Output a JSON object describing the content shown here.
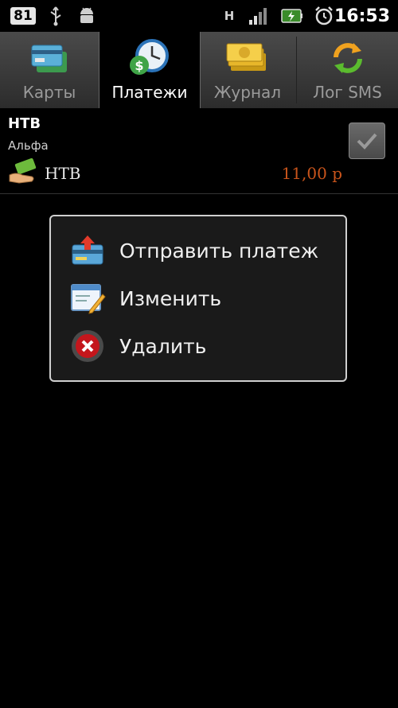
{
  "status_bar": {
    "notification_count": "81",
    "network_type": "H",
    "time": "16:53"
  },
  "tabs": [
    {
      "label": "Карты",
      "icon": "cards-icon",
      "active": false
    },
    {
      "label": "Платежи",
      "icon": "payments-clock-icon",
      "active": true
    },
    {
      "label": "Журнал",
      "icon": "money-stack-icon",
      "active": false
    },
    {
      "label": "Лог SMS",
      "icon": "refresh-arrows-icon",
      "active": false
    }
  ],
  "payment": {
    "title": "НТВ",
    "bank": "Альфа",
    "service": "НТВ",
    "amount": "11,00 р",
    "checked": true
  },
  "context_menu": {
    "items": [
      {
        "label": "Отправить платеж",
        "icon": "send-payment-icon"
      },
      {
        "label": "Изменить",
        "icon": "edit-icon"
      },
      {
        "label": "Удалить",
        "icon": "delete-icon"
      }
    ]
  },
  "colors": {
    "amount": "#c8541b",
    "background": "#000000",
    "popup_border": "#cfcfcf"
  }
}
